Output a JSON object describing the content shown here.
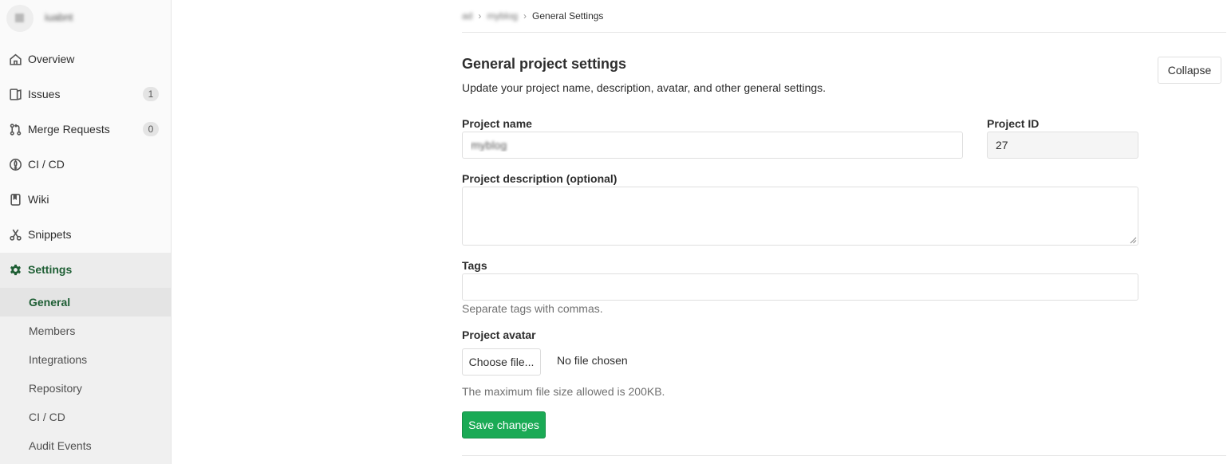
{
  "sidebar": {
    "project_initial": "■",
    "project_name": "iuabnt",
    "items": [
      {
        "label": "Overview",
        "icon": "home-icon"
      },
      {
        "label": "Issues",
        "icon": "issues-icon",
        "count": "1"
      },
      {
        "label": "Merge Requests",
        "icon": "merge-request-icon",
        "count": "0"
      },
      {
        "label": "CI / CD",
        "icon": "rocket-icon"
      },
      {
        "label": "Wiki",
        "icon": "book-icon"
      },
      {
        "label": "Snippets",
        "icon": "scissors-icon"
      },
      {
        "label": "Settings",
        "icon": "gear-icon"
      }
    ],
    "settings_subitems": [
      {
        "label": "General"
      },
      {
        "label": "Members"
      },
      {
        "label": "Integrations"
      },
      {
        "label": "Repository"
      },
      {
        "label": "CI / CD"
      },
      {
        "label": "Audit Events"
      }
    ]
  },
  "breadcrumbs": {
    "group": "ad",
    "project": "myblog",
    "current": "General Settings",
    "separator": "›"
  },
  "settings": {
    "title": "General project settings",
    "description": "Update your project name, description, avatar, and other general settings.",
    "collapse_label": "Collapse",
    "project_name_label": "Project name",
    "project_name_value": "myblog",
    "project_id_label": "Project ID",
    "project_id_value": "27",
    "description_label": "Project description (optional)",
    "description_value": "",
    "tags_label": "Tags",
    "tags_value": "",
    "tags_help": "Separate tags with commas.",
    "avatar_label": "Project avatar",
    "choose_file_label": "Choose file...",
    "file_status": "No file chosen",
    "avatar_help": "The maximum file size allowed is 200KB.",
    "save_label": "Save changes"
  },
  "colors": {
    "accent": "#1aaa55",
    "active_text": "#1e5e34"
  }
}
